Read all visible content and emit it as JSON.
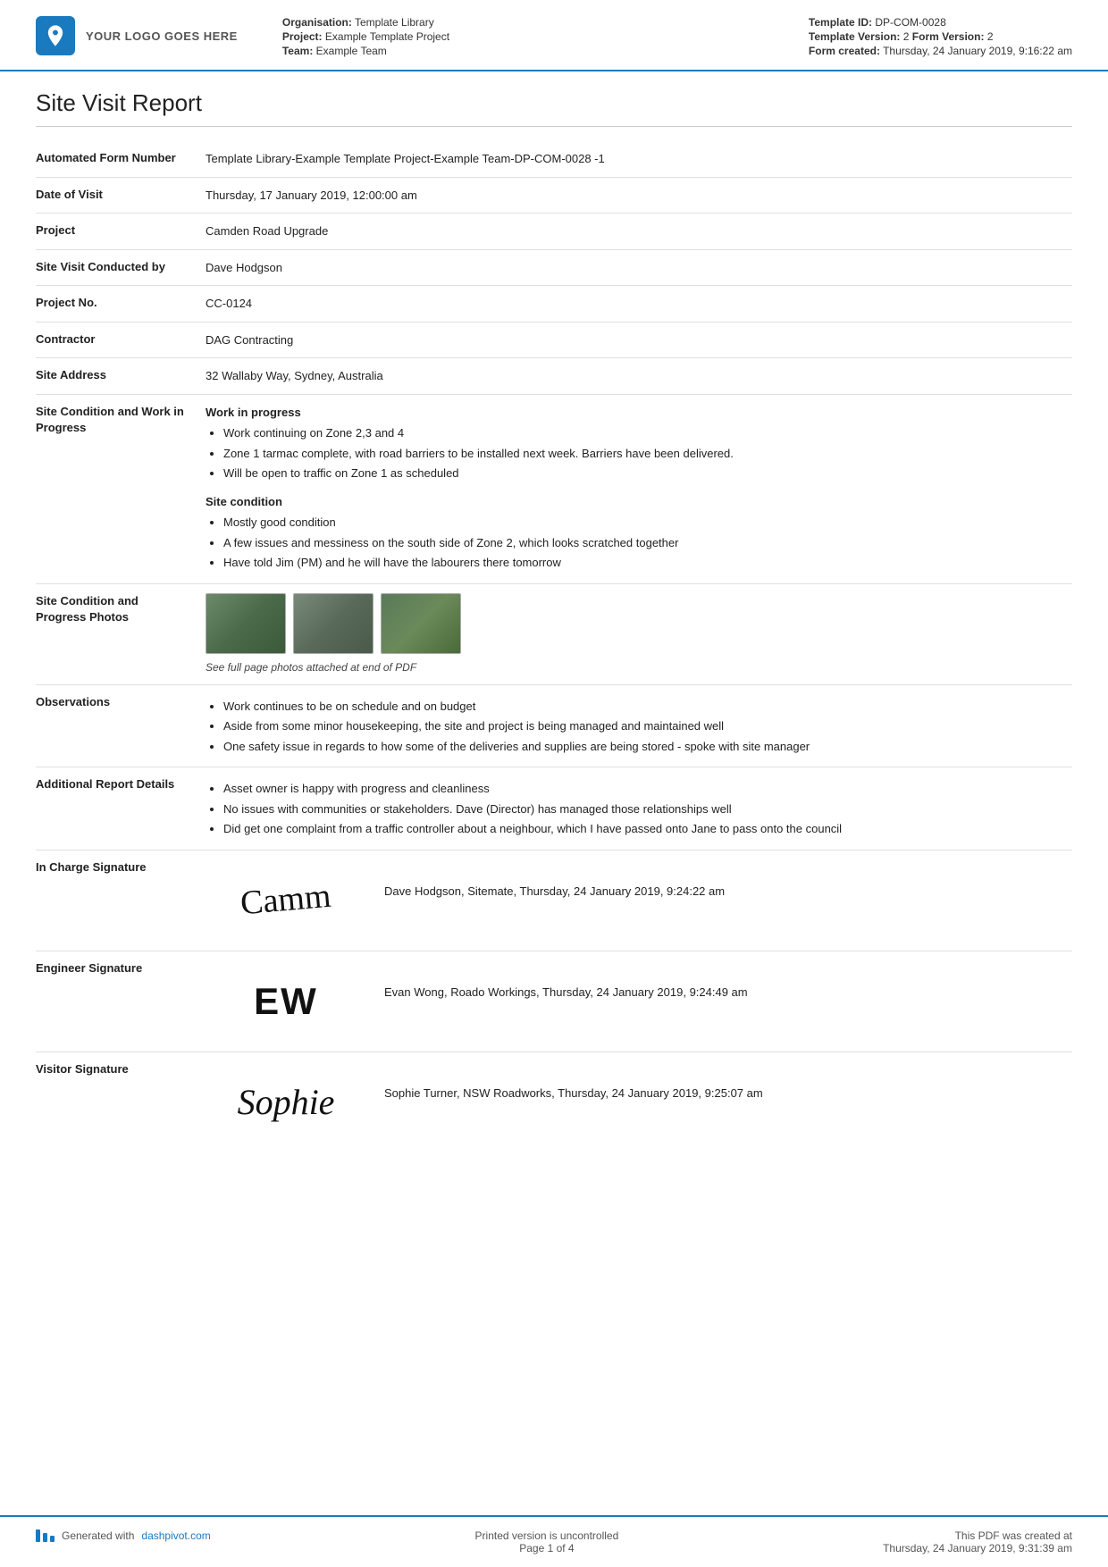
{
  "header": {
    "logo_text": "YOUR LOGO GOES HERE",
    "organisation_label": "Organisation:",
    "organisation_value": "Template Library",
    "project_label": "Project:",
    "project_value": "Example Template Project",
    "team_label": "Team:",
    "team_value": "Example Team",
    "template_id_label": "Template ID:",
    "template_id_value": "DP-COM-0028",
    "template_version_label": "Template Version:",
    "template_version_value": "2",
    "form_version_label": "Form Version:",
    "form_version_value": "2",
    "form_created_label": "Form created:",
    "form_created_value": "Thursday, 24 January 2019, 9:16:22 am"
  },
  "report": {
    "title": "Site Visit Report",
    "form_number_label": "Automated Form Number",
    "form_number_value": "Template Library-Example Template Project-Example Team-DP-COM-0028   -1",
    "date_of_visit_label": "Date of Visit",
    "date_of_visit_value": "Thursday, 17 January 2019, 12:00:00 am",
    "project_label": "Project",
    "project_value": "Camden Road Upgrade",
    "site_visit_conducted_label": "Site Visit Conducted by",
    "site_visit_conducted_value": "Dave Hodgson",
    "project_no_label": "Project No.",
    "project_no_value": "CC-0124",
    "contractor_label": "Contractor",
    "contractor_value": "DAG Contracting",
    "site_address_label": "Site Address",
    "site_address_value": "32 Wallaby Way, Sydney, Australia",
    "site_condition_label": "Site Condition and Work in Progress",
    "work_in_progress_heading": "Work in progress",
    "work_bullet_1": "Work continuing on Zone 2,3 and 4",
    "work_bullet_2": "Zone 1 tarmac complete, with road barriers to be installed next week. Barriers have been delivered.",
    "work_bullet_3": "Will be open to traffic on Zone 1 as scheduled",
    "site_condition_heading": "Site condition",
    "site_bullet_1": "Mostly good condition",
    "site_bullet_2": "A few issues and messiness on the south side of Zone 2, which looks scratched together",
    "site_bullet_3": "Have told Jim (PM) and he will have the labourers there tomorrow",
    "photos_label": "Site Condition and Progress Photos",
    "photos_caption": "See full page photos attached at end of PDF",
    "observations_label": "Observations",
    "obs_bullet_1": "Work continues to be on schedule and on budget",
    "obs_bullet_2": "Aside from some minor housekeeping, the site and project is being managed and maintained well",
    "obs_bullet_3": "One safety issue in regards to how some of the deliveries and supplies are being stored - spoke with site manager",
    "additional_label": "Additional Report Details",
    "add_bullet_1": "Asset owner is happy with progress and cleanliness",
    "add_bullet_2": "No issues with communities or stakeholders. Dave (Director) has managed those relationships well",
    "add_bullet_3": "Did get one complaint from a traffic controller about a neighbour, which I have passed onto Jane to pass onto the council",
    "in_charge_signature_label": "In Charge Signature",
    "in_charge_sig_text": "Camm",
    "in_charge_sig_info": "Dave Hodgson, Sitemate, Thursday, 24 January 2019, 9:24:22 am",
    "engineer_signature_label": "Engineer Signature",
    "engineer_sig_text": "EW",
    "engineer_sig_info": "Evan Wong, Roado Workings, Thursday, 24 January 2019, 9:24:49 am",
    "visitor_signature_label": "Visitor Signature",
    "visitor_sig_text": "Sophie",
    "visitor_sig_info": "Sophie Turner, NSW Roadworks, Thursday, 24 January 2019, 9:25:07 am"
  },
  "footer": {
    "generated_text": "Generated with",
    "dashpivot_link": "dashpivot.com",
    "center_text": "Printed version is uncontrolled",
    "page_text": "Page 1 of 4",
    "right_text": "This PDF was created at",
    "right_date": "Thursday, 24 January 2019, 9:31:39 am"
  }
}
